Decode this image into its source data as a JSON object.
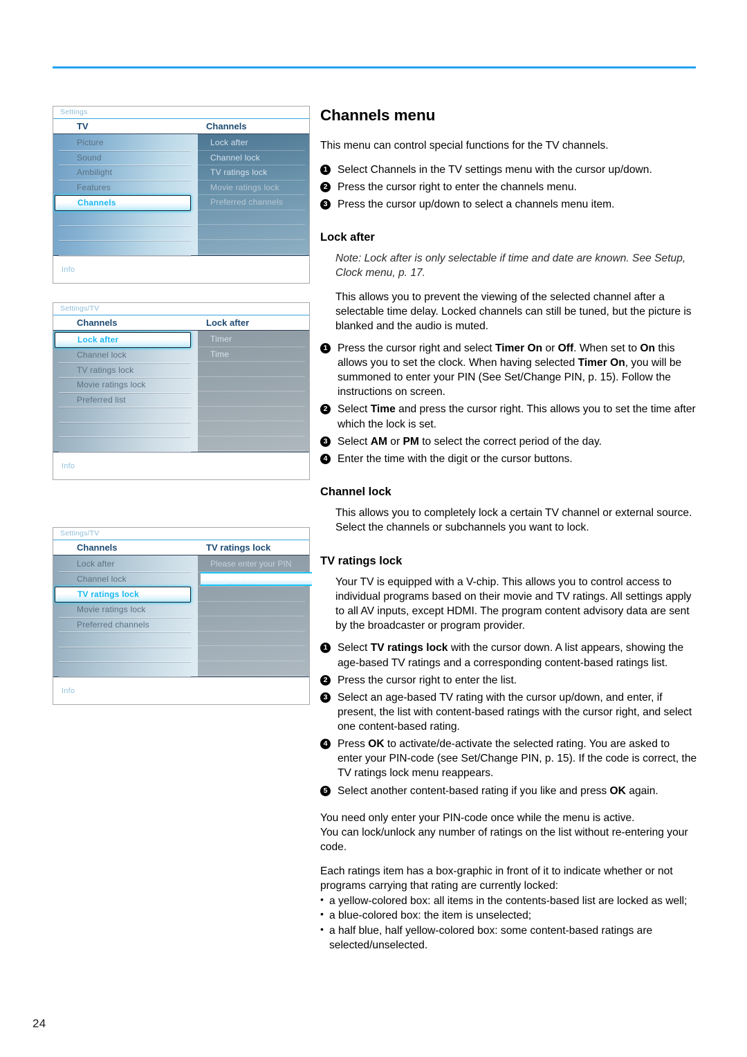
{
  "page": {
    "number": "24"
  },
  "osd_menus": [
    {
      "breadcrumb": "Settings",
      "left_title": "TV",
      "right_title": "Channels",
      "left_items": [
        "Picture",
        "Sound",
        "Ambilight",
        "Features",
        "Channels"
      ],
      "left_selected_index": 4,
      "right_items": [
        "Lock after",
        "Channel lock",
        "TV ratings lock",
        "Movie ratings lock",
        "Preferred channels"
      ],
      "info_label": "Info"
    },
    {
      "breadcrumb": "Settings/TV",
      "left_title": "Channels",
      "right_title": "Lock after",
      "left_items": [
        "Lock after",
        "Channel lock",
        "TV ratings lock",
        "Movie ratings lock",
        "Preferred list"
      ],
      "left_selected_index": 0,
      "right_items": [
        "Timer",
        "Time"
      ],
      "info_label": "Info"
    },
    {
      "breadcrumb": "Settings/TV",
      "left_title": "Channels",
      "right_title": "TV ratings lock",
      "left_items": [
        "Lock after",
        "Channel lock",
        "TV ratings lock",
        "Movie ratings lock",
        "Preferred channels"
      ],
      "left_selected_index": 2,
      "right_items": [],
      "pin_prompt": "Please enter your PIN",
      "pin_value": "- - - -",
      "info_label": "Info"
    }
  ],
  "article": {
    "title": "Channels menu",
    "intro": "This menu can control special functions for the TV channels.",
    "intro_steps": [
      "Select Channels in the TV settings menu with the cursor up/down.",
      "Press the cursor right to enter the channels menu.",
      "Press the cursor up/down to select a channels menu item."
    ],
    "lock_after": {
      "heading": "Lock after",
      "note": "Note: Lock after is only selectable if time and date are known. See Setup, Clock menu, p. 17.",
      "body": "This allows you to prevent the viewing of the selected channel after a selectable time delay. Locked channels can still be tuned, but the picture is blanked and the audio is muted.",
      "step1_a": "Press the cursor right and select ",
      "step1_b": "Timer On",
      "step1_c": " or ",
      "step1_d": "Off",
      "step1_e": ". When set to ",
      "step1_f": "On",
      "step1_g": " this allows you to set the clock. When having selected ",
      "step1_h": "Timer On",
      "step1_i": ", you will be summoned to enter your PIN (See Set/Change PIN, p. 15). Follow the instructions on screen.",
      "step2_a": "Select ",
      "step2_b": "Time",
      "step2_c": " and press the cursor right. This allows you to set the time after which the lock is set.",
      "step3_a": "Select ",
      "step3_b": "AM",
      "step3_c": " or ",
      "step3_d": "PM",
      "step3_e": " to select the correct period of the day.",
      "step4": "Enter the time with the digit or the cursor buttons."
    },
    "channel_lock": {
      "heading": "Channel lock",
      "body": "This allows you to completely lock a certain TV channel or external source. Select the channels or subchannels you want to lock."
    },
    "tv_ratings_lock": {
      "heading": "TV ratings lock",
      "body": "Your TV is equipped with a V-chip. This allows you to control access to individual programs based on their movie and TV ratings. All settings apply to all AV inputs, except HDMI. The program content advisory data are sent by the broadcaster or program provider.",
      "step1_a": "Select ",
      "step1_b": "TV ratings lock",
      "step1_c": " with the cursor down. A list appears, showing the age-based TV ratings and a corresponding content-based ratings list.",
      "step2": "Press the cursor right to enter the list.",
      "step3": "Select an age-based TV rating with the cursor up/down, and enter, if present, the list with content-based ratings with the cursor right, and select one content-based rating.",
      "step4_a": "Press ",
      "step4_b": "OK",
      "step4_c": " to activate/de-activate the selected rating. You are asked to enter your PIN-code (see Set/Change PIN, p. 15). If the code is correct, the TV ratings lock menu reappears.",
      "step5_a": "Select another content-based rating if you like and press ",
      "step5_b": "OK",
      "step5_c": " again.",
      "para_pin_1": "You need only enter your PIN-code once while the menu is active.",
      "para_pin_2": "You can lock/unlock any number of ratings on the list without re-entering your code.",
      "para_box": "Each ratings item has a box-graphic in front of it to indicate whether or not programs carrying that rating are currently locked:",
      "bullets": [
        "a yellow-colored box: all items in the contents-based list are locked as well;",
        "a blue-colored box: the item is unselected;",
        "a half blue, half yellow-colored box: some content-based ratings are selected/unselected."
      ]
    }
  }
}
